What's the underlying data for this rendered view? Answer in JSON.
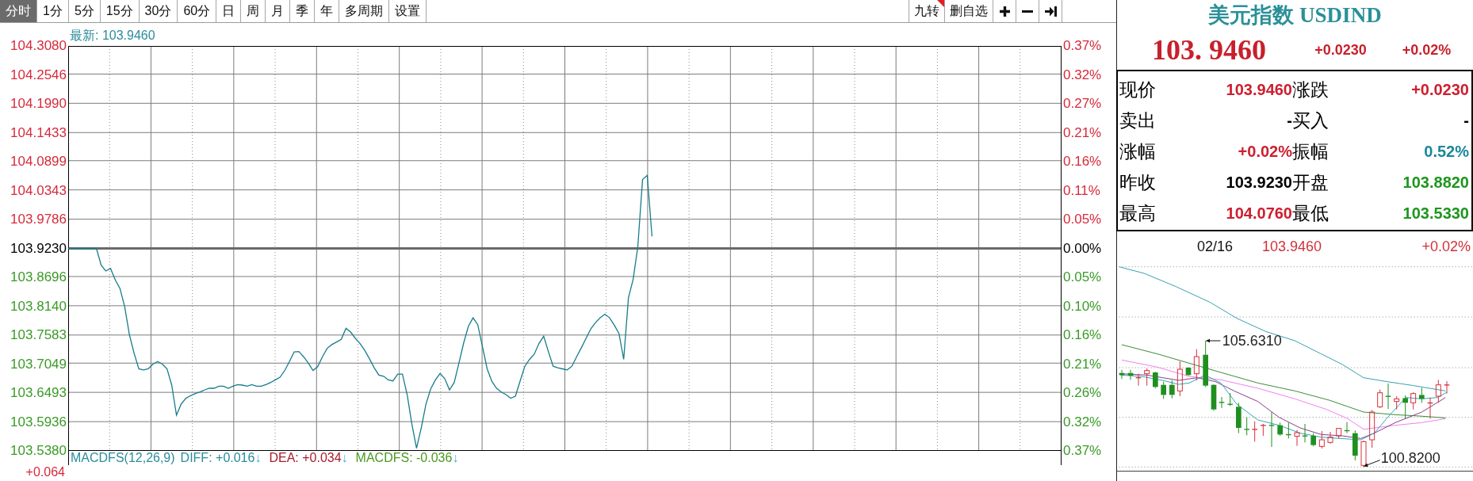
{
  "toolbar": {
    "periods": [
      {
        "label": "分时",
        "selected": true
      },
      {
        "label": "1分",
        "selected": false
      },
      {
        "label": "5分",
        "selected": false
      },
      {
        "label": "15分",
        "selected": false
      },
      {
        "label": "30分",
        "selected": false
      },
      {
        "label": "60分",
        "selected": false
      },
      {
        "label": "日",
        "selected": false
      },
      {
        "label": "周",
        "selected": false
      },
      {
        "label": "月",
        "selected": false
      },
      {
        "label": "季",
        "selected": false
      },
      {
        "label": "年",
        "selected": false
      }
    ],
    "tools": [
      {
        "label": "多周期"
      },
      {
        "label": "设置"
      }
    ],
    "actions": [
      {
        "kind": "text",
        "label": "九转",
        "marked": true
      },
      {
        "kind": "text",
        "label": "删自选",
        "marked": false
      },
      {
        "kind": "plus",
        "marked": false
      },
      {
        "kind": "minus",
        "marked": false
      },
      {
        "kind": "end",
        "marked": false
      }
    ]
  },
  "main_chart": {
    "latest": "最新: 103.9460",
    "chart_data": {
      "type": "line",
      "grid": true,
      "ylim": [
        103.538,
        104.308
      ],
      "yticks": [
        {
          "value": 104.308,
          "label": "104.3080"
        },
        {
          "value": 104.2546,
          "label": "104.2546"
        },
        {
          "value": 104.199,
          "label": "104.1990"
        },
        {
          "value": 104.1433,
          "label": "104.1433"
        },
        {
          "value": 104.0899,
          "label": "104.0899"
        },
        {
          "value": 104.0343,
          "label": "104.0343"
        },
        {
          "value": 103.9786,
          "label": "103.9786"
        },
        {
          "value": 103.923,
          "label": "103.9230"
        },
        {
          "value": 103.8696,
          "label": "103.8696"
        },
        {
          "value": 103.814,
          "label": "103.8140"
        },
        {
          "value": 103.7583,
          "label": "103.7583"
        },
        {
          "value": 103.7049,
          "label": "103.7049"
        },
        {
          "value": 103.6493,
          "label": "103.6493"
        },
        {
          "value": 103.5936,
          "label": "103.5936"
        },
        {
          "value": 103.538,
          "label": "103.5380"
        }
      ],
      "series": [
        {
          "color": "#177c8a",
          "values": [
            103.923,
            103.923,
            103.923,
            103.923,
            103.923,
            103.923,
            103.923,
            103.891,
            103.88,
            103.885,
            103.863,
            103.847,
            103.812,
            103.759,
            103.724,
            103.694,
            103.692,
            103.694,
            103.703,
            103.708,
            103.703,
            103.694,
            103.663,
            103.606,
            103.627,
            103.638,
            103.643,
            103.647,
            103.65,
            103.654,
            103.657,
            103.657,
            103.661,
            103.661,
            103.657,
            103.661,
            103.664,
            103.663,
            103.661,
            103.664,
            103.661,
            103.661,
            103.664,
            103.668,
            103.673,
            103.678,
            103.691,
            103.708,
            103.726,
            103.727,
            103.717,
            103.705,
            103.691,
            103.698,
            103.717,
            103.733,
            103.74,
            103.745,
            103.75,
            103.771,
            103.764,
            103.752,
            103.742,
            103.729,
            103.713,
            103.696,
            103.682,
            103.68,
            103.673,
            103.671,
            103.684,
            103.684,
            103.645,
            103.589,
            103.543,
            103.582,
            103.627,
            103.656,
            103.673,
            103.685,
            103.675,
            103.654,
            103.668,
            103.705,
            103.743,
            103.775,
            103.791,
            103.778,
            103.736,
            103.694,
            103.67,
            103.657,
            103.65,
            103.645,
            103.638,
            103.642,
            103.671,
            103.699,
            103.712,
            103.722,
            103.742,
            103.756,
            103.727,
            103.699,
            103.696,
            103.694,
            103.692,
            103.699,
            103.717,
            103.734,
            103.752,
            103.77,
            103.782,
            103.791,
            103.798,
            103.791,
            103.777,
            103.761,
            103.712,
            103.829,
            103.864,
            103.926,
            104.054,
            104.062,
            103.946,
            null,
            null,
            null,
            null,
            null,
            null,
            null,
            null,
            null,
            null,
            null,
            null,
            null,
            null,
            null,
            null,
            null,
            null,
            null,
            null,
            null,
            null,
            null,
            null,
            null,
            null,
            null,
            null,
            null,
            null,
            null,
            null,
            null,
            null,
            null,
            null,
            null,
            null,
            null,
            null,
            null,
            null,
            null,
            null,
            null,
            null,
            null,
            null,
            null,
            null,
            null,
            null,
            null,
            null,
            null,
            null,
            null,
            null,
            null,
            null,
            null,
            null,
            null,
            null,
            null,
            null,
            null,
            null,
            null,
            null,
            null,
            null,
            null,
            null,
            null,
            null,
            null,
            null,
            null,
            null,
            null,
            null,
            null,
            null,
            null,
            null,
            null
          ]
        }
      ],
      "ref_lines": [
        {
          "axis": "y",
          "value": 103.923
        }
      ]
    },
    "percent_axis": [
      "0.37%",
      "0.32%",
      "0.27%",
      "0.21%",
      "0.16%",
      "0.11%",
      "0.05%",
      "0.00%",
      "0.05%",
      "0.10%",
      "0.16%",
      "0.21%",
      "0.26%",
      "0.32%",
      "0.37%"
    ],
    "indicator": {
      "title": "MACDFS(12,26,9)",
      "readings": [
        {
          "label": "DIFF: +0.016",
          "arrow": "↓",
          "color": "#2a8c9c"
        },
        {
          "label": "DEA: +0.034",
          "arrow": "↓",
          "color": "#a81c2c"
        },
        {
          "label": "MACDFS: -0.036",
          "arrow": "↓",
          "color": "#4a9a20"
        }
      ]
    },
    "indicator_axis_label": "+0.064"
  },
  "quote_panel": {
    "title": "美元指数 USDIND",
    "price": "103. 9460",
    "change": "+0.0230",
    "change_pct": "+0.02%",
    "rows": [
      {
        "cells": [
          {
            "label": "现价",
            "value": "103.9460",
            "color": "#cc2030"
          },
          {
            "label": "涨跌",
            "value": "+0.0230",
            "color": "#cc2030"
          }
        ]
      },
      {
        "cells": [
          {
            "label": "卖出",
            "value": "-",
            "color": "#000000"
          },
          {
            "label": "买入",
            "value": "-",
            "color": "#000000"
          }
        ]
      },
      {
        "cells": [
          {
            "label": "涨幅",
            "value": "+0.02%",
            "color": "#cc2030"
          },
          {
            "label": "振幅",
            "value": "0.52%",
            "color": "#1a8898"
          }
        ]
      },
      {
        "cells": [
          {
            "label": "昨收",
            "value": "103.9230",
            "color": "#000000"
          },
          {
            "label": "开盘",
            "value": "103.8820",
            "color": "#1e961e"
          }
        ]
      },
      {
        "cells": [
          {
            "label": "最高",
            "value": "104.0760",
            "color": "#cc2030"
          },
          {
            "label": "最低",
            "value": "103.5330",
            "color": "#1e961e"
          }
        ]
      }
    ]
  },
  "kline_panel": {
    "date": "02/16",
    "price": "103.9460",
    "change_pct": "+0.02%",
    "high_label": "105.6310",
    "low_label": "100.8200"
  }
}
